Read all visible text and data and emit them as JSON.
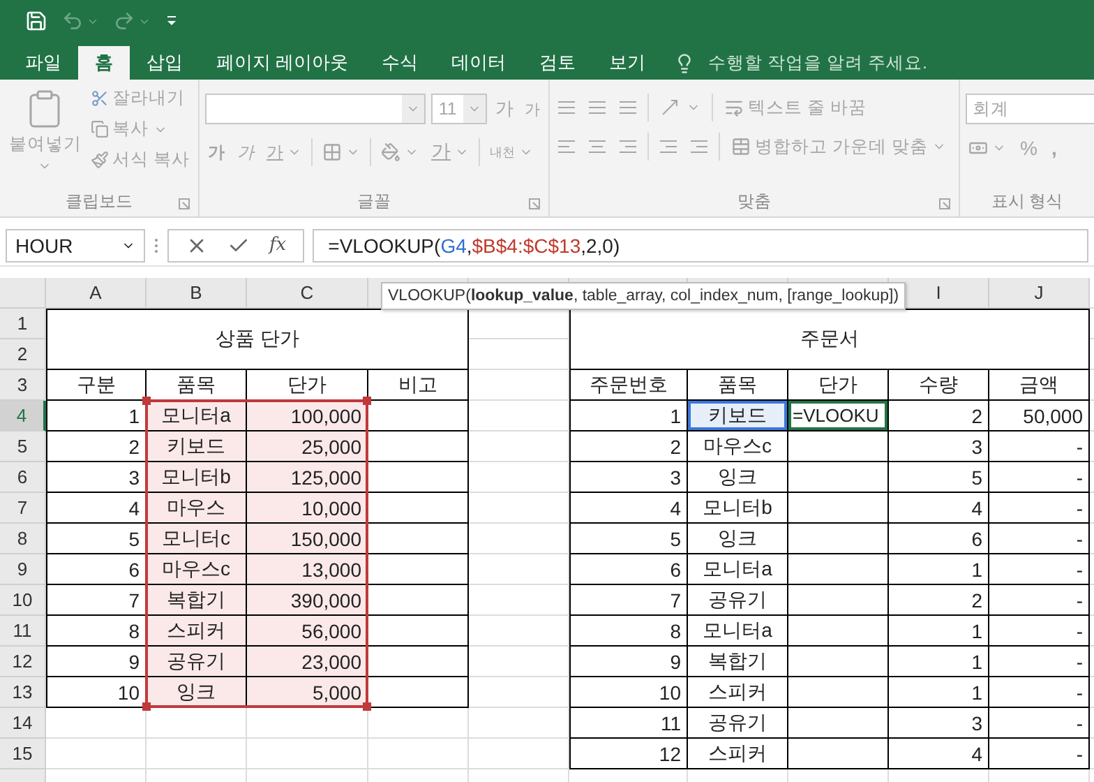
{
  "tabs": [
    {
      "label": "파일",
      "selected": false
    },
    {
      "label": "홈",
      "selected": true
    },
    {
      "label": "삽입",
      "selected": false
    },
    {
      "label": "페이지 레이아웃",
      "selected": false
    },
    {
      "label": "수식",
      "selected": false
    },
    {
      "label": "데이터",
      "selected": false
    },
    {
      "label": "검토",
      "selected": false
    },
    {
      "label": "보기",
      "selected": false
    }
  ],
  "tell_me": "수행할 작업을 알려 주세요.",
  "ribbon": {
    "disabled": true,
    "clipboard": {
      "paste": "붙여넣기",
      "cut": "잘라내기",
      "copy": "복사",
      "format_painter": "서식 복사",
      "label": "클립보드"
    },
    "font": {
      "size": "11",
      "grow": "가",
      "shrink": "가",
      "bold": "가",
      "italic": "가",
      "underline": "가",
      "font_color": "가",
      "phonetic": "내천",
      "label": "글꼴"
    },
    "alignment": {
      "wrap_text": "텍스트 줄 바꿈",
      "merge": "병합하고 가운데 맞춤",
      "label": "맞춤"
    },
    "number": {
      "format": "회계",
      "percent": "%",
      "comma": ",",
      "label": "표시 형식"
    }
  },
  "formula_bar": {
    "name_box": "HOUR",
    "function_button": "fx",
    "formula": [
      {
        "text": "=VLOOKUP(",
        "color": "#222222"
      },
      {
        "text": "G4",
        "color": "#2f6fce"
      },
      {
        "prefix": ",",
        "text": "$B$4:$C$13",
        "color": "#c0392b"
      },
      {
        "text": ",2,0)",
        "color": "#222222"
      }
    ]
  },
  "tooltip": "VLOOKUP(**lookup_value**, table_array, col_index_num, [range_lookup])",
  "column_headers": [
    "A",
    "B",
    "C",
    "I",
    "J"
  ],
  "row_headers": [
    {
      "label": "1",
      "selected": false
    },
    {
      "label": "2",
      "selected": false
    },
    {
      "label": "3",
      "selected": false
    },
    {
      "label": "4",
      "selected": true
    },
    {
      "label": "5",
      "selected": false
    },
    {
      "label": "6",
      "selected": false
    },
    {
      "label": "7",
      "selected": false
    },
    {
      "label": "8",
      "selected": false
    },
    {
      "label": "9",
      "selected": false
    },
    {
      "label": "10",
      "selected": false
    },
    {
      "label": "11",
      "selected": false
    },
    {
      "label": "12",
      "selected": false
    },
    {
      "label": "13",
      "selected": false
    },
    {
      "label": "14",
      "selected": false
    },
    {
      "label": "15",
      "selected": false
    }
  ],
  "price_table": {
    "title": "상품 단가",
    "columns": [
      {
        "label": "구분",
        "kind": "number",
        "highlighted": false
      },
      {
        "label": "품목",
        "kind": "item",
        "highlighted": true
      },
      {
        "label": "단가",
        "kind": "price",
        "highlighted": true
      },
      {
        "label": "비고",
        "kind": "note",
        "highlighted": false
      }
    ],
    "rows": [
      [
        "1",
        "모니터a",
        "100,000"
      ],
      [
        "2",
        "키보드",
        "25,000"
      ],
      [
        "3",
        "모니터b",
        "125,000"
      ],
      [
        "4",
        "마우스",
        "10,000"
      ],
      [
        "5",
        "모니터c",
        "150,000"
      ],
      [
        "6",
        "마우스c",
        "13,000"
      ],
      [
        "7",
        "복합기",
        "390,000"
      ],
      [
        "8",
        "스피커",
        "56,000"
      ],
      [
        "9",
        "공유기",
        "23,000"
      ],
      [
        "10",
        "잉크",
        "5,000"
      ]
    ]
  },
  "order_table": {
    "title": "주문서",
    "columns": [
      {
        "label": "주문번호",
        "kind": "number"
      },
      {
        "label": "품목",
        "kind": "item"
      },
      {
        "label": "단가",
        "kind": "price"
      },
      {
        "label": "수량",
        "kind": "quantity"
      },
      {
        "label": "금액",
        "kind": "amount"
      }
    ],
    "rows": [
      {
        "cells": [
          "1",
          "키보드",
          "=VLOOKU",
          "2",
          "50,000"
        ],
        "referenced": true,
        "editing": true
      },
      {
        "cells": [
          "2",
          "마우스c",
          "",
          "3",
          "-"
        ],
        "referenced": false,
        "editing": false
      },
      {
        "cells": [
          "3",
          "잉크",
          "",
          "5",
          "-"
        ],
        "referenced": false,
        "editing": false
      },
      {
        "cells": [
          "4",
          "모니터b",
          "",
          "4",
          "-"
        ],
        "referenced": false,
        "editing": false
      },
      {
        "cells": [
          "5",
          "잉크",
          "",
          "6",
          "-"
        ],
        "referenced": false,
        "editing": false
      },
      {
        "cells": [
          "6",
          "모니터a",
          "",
          "1",
          "-"
        ],
        "referenced": false,
        "editing": false
      },
      {
        "cells": [
          "7",
          "공유기",
          "",
          "2",
          "-"
        ],
        "referenced": false,
        "editing": false
      },
      {
        "cells": [
          "8",
          "모니터a",
          "",
          "1",
          "-"
        ],
        "referenced": false,
        "editing": false
      },
      {
        "cells": [
          "9",
          "복합기",
          "",
          "1",
          "-"
        ],
        "referenced": false,
        "editing": false
      },
      {
        "cells": [
          "10",
          "스피커",
          "",
          "1",
          "-"
        ],
        "referenced": false,
        "editing": false
      },
      {
        "cells": [
          "11",
          "공유기",
          "",
          "3",
          "-"
        ],
        "referenced": false,
        "editing": false
      },
      {
        "cells": [
          "12",
          "스피커",
          "",
          "4",
          "-"
        ],
        "referenced": false,
        "editing": false
      }
    ]
  }
}
